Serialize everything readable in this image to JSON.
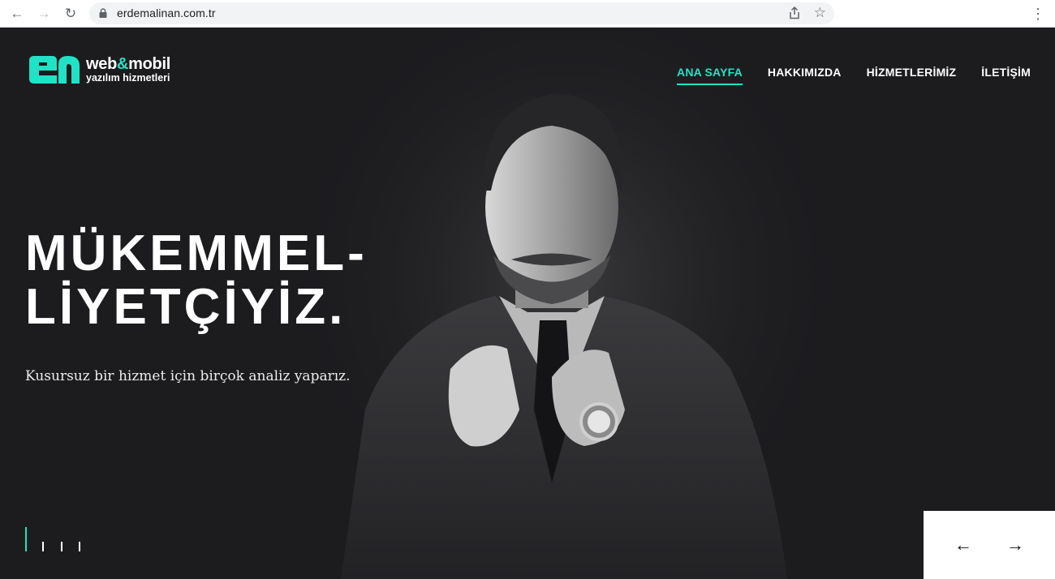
{
  "browser": {
    "url": "erdemalinan.com.tr",
    "back_icon": "←",
    "forward_icon": "→",
    "reload_icon": "↻",
    "star_icon": "☆",
    "menu_icon": "⋮"
  },
  "logo": {
    "line1_a": "web",
    "line1_amp": "&",
    "line1_b": "mobil",
    "line2": "yazılım hizmetleri"
  },
  "nav": {
    "items": [
      {
        "label": "ANA SAYFA",
        "active": true
      },
      {
        "label": "HAKKIMIZDA"
      },
      {
        "label": "HİZMETLERİMİZ"
      },
      {
        "label": "İLETİŞİM"
      }
    ]
  },
  "hero": {
    "headline_line1": "MÜKEMMEL-",
    "headline_line2": "LİYETÇİYİZ.",
    "subtitle": "Kusursuz bir hizmet için birçok analiz yaparız."
  },
  "slider": {
    "slide_count": 4,
    "active_index": 0,
    "prev_icon": "←",
    "next_icon": "→"
  },
  "colors": {
    "accent": "#22e2c6",
    "background": "#1c1c1f"
  }
}
